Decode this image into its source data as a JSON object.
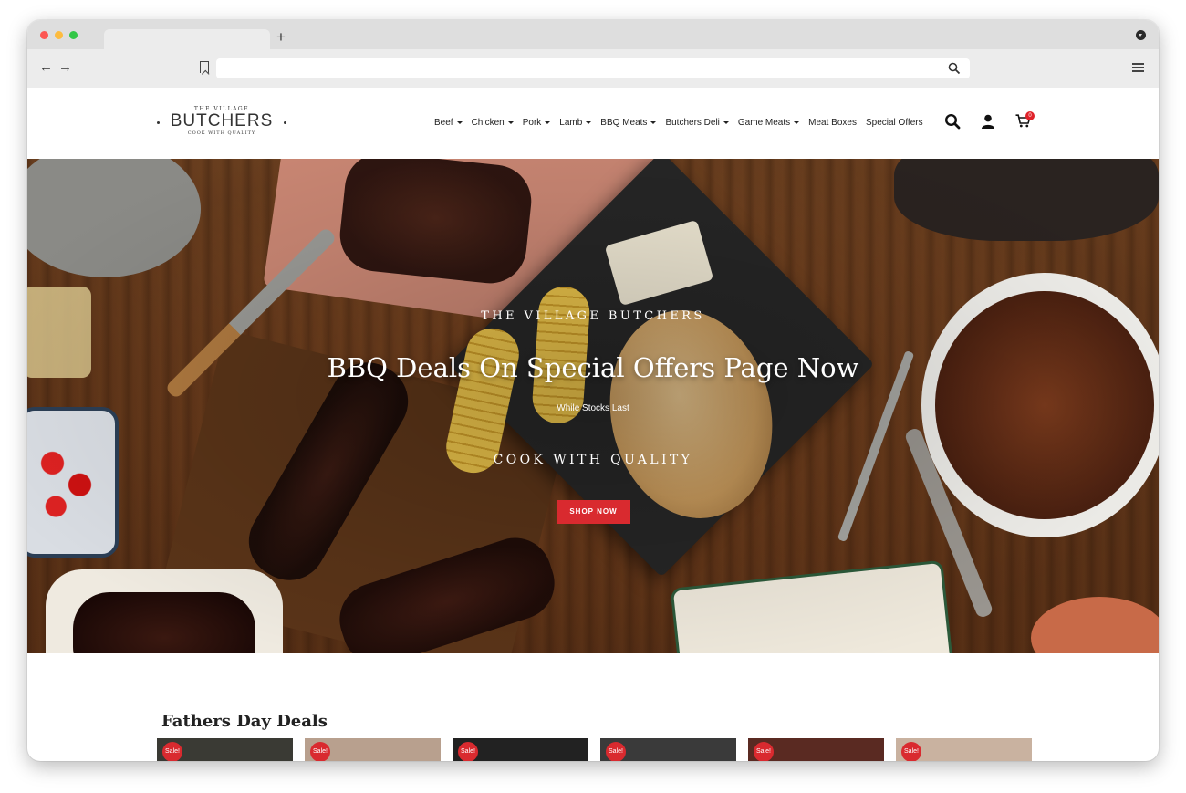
{
  "browser": {
    "new_tab_label": "+",
    "back_label": "←",
    "forward_label": "→",
    "url_value": ""
  },
  "logo": {
    "top": "THE VILLAGE",
    "main": "BUTCHERS",
    "sub": "COOK WITH QUALITY"
  },
  "nav": {
    "items": [
      {
        "label": "Beef",
        "dropdown": true
      },
      {
        "label": "Chicken",
        "dropdown": true
      },
      {
        "label": "Pork",
        "dropdown": true
      },
      {
        "label": "Lamb",
        "dropdown": true
      },
      {
        "label": "BBQ Meats",
        "dropdown": true
      },
      {
        "label": "Butchers Deli",
        "dropdown": true
      },
      {
        "label": "Game Meats",
        "dropdown": true
      },
      {
        "label": "Meat Boxes",
        "dropdown": false
      },
      {
        "label": "Special Offers",
        "dropdown": false
      }
    ],
    "icons": [
      "search-icon",
      "user-icon",
      "cart-icon"
    ],
    "cart_count": "0"
  },
  "hero": {
    "kicker": "THE VILLAGE BUTCHERS",
    "title": "BBQ Deals On Special Offers Page Now",
    "subtitle": "While Stocks Last",
    "tagline": "COOK WITH QUALITY",
    "cta_label": "SHOP NOW"
  },
  "deals": {
    "title": "Fathers Day Deals",
    "products": [
      {
        "badge": "Sale!",
        "color": "#3a3a34"
      },
      {
        "badge": "Sale!",
        "color": "#b8a08e"
      },
      {
        "badge": "Sale!",
        "color": "#222222"
      },
      {
        "badge": "Sale!",
        "color": "#3a3a3a"
      },
      {
        "badge": "Sale!",
        "color": "#5a2a22"
      },
      {
        "badge": "Sale!",
        "color": "#c9b2a0"
      }
    ]
  },
  "colors": {
    "accent": "#d92a2f",
    "cart_badge": "#e0222a"
  }
}
